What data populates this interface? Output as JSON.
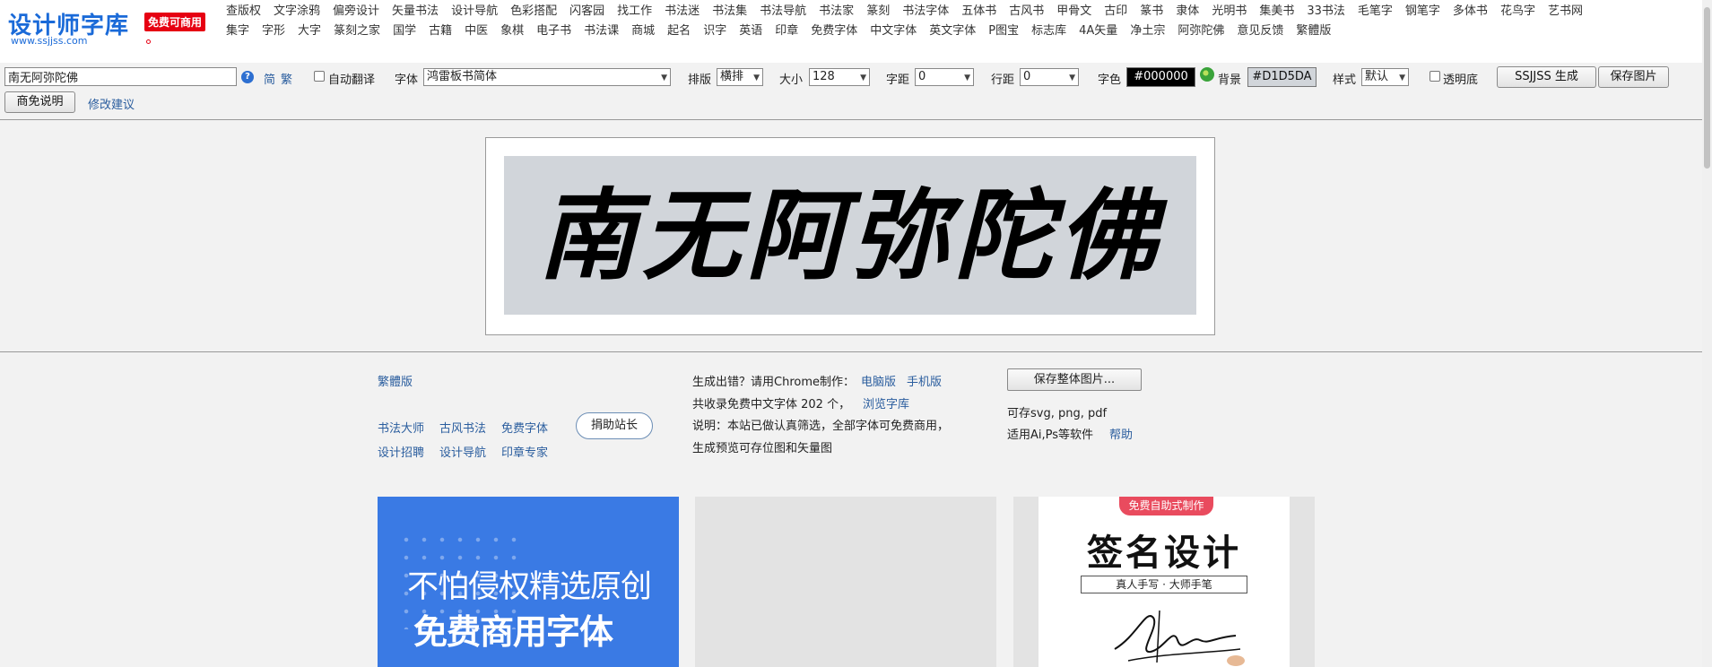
{
  "logo": {
    "name": "设计师字库",
    "badge": "免费可商用",
    "url": "www.ssjjss.com"
  },
  "nav": {
    "row1": [
      "查版权",
      "文字涂鸦",
      "偏旁设计",
      "矢量书法",
      "设计导航",
      "色彩搭配",
      "闪客园",
      "找工作",
      "书法迷",
      "书法集",
      "书法导航",
      "书法家",
      "篆刻",
      "书法字体",
      "五体书",
      "古风书",
      "甲骨文",
      "古印",
      "篆书",
      "隶体",
      "光明书",
      "集美书",
      "33书法",
      "毛笔字",
      "钢笔字",
      "多体书",
      "花鸟字",
      "艺书网"
    ],
    "row2": [
      "集字",
      "字形",
      "大字",
      "篆刻之家",
      "国学",
      "古籍",
      "中医",
      "象棋",
      "电子书",
      "书法课",
      "商城",
      "起名",
      "识字",
      "英语",
      "印章",
      "免费字体",
      "中文字体",
      "英文字体",
      "P图宝",
      "标志库",
      "4A矢量",
      "净土宗",
      "阿弥陀佛",
      "意见反馈",
      "繁體版"
    ]
  },
  "toolbar": {
    "text_value": "南无阿弥陀佛",
    "help_icon": "question-circle-icon",
    "simplified": "简",
    "traditional": "繁",
    "auto_translate": "自动翻译",
    "font_label": "字体",
    "font_value": "鸿雷板书简体",
    "layout_label": "排版",
    "layout_value": "横排",
    "size_label": "大小",
    "size_value": "128",
    "spacing_label": "字距",
    "spacing_value": "0",
    "line_label": "行距",
    "line_value": "0",
    "color_label": "字色",
    "color_value": "#000000",
    "bg_label": "背景",
    "bg_value": "#D1D5DA",
    "style_label": "样式",
    "style_value": "默认",
    "transparent": "透明底",
    "generate_button": "SSJJSS 生成",
    "save_button": "保存图片",
    "commercial_button": "商免说明",
    "suggest_link": "修改建议",
    "colors": {
      "text": "#000000",
      "background": "#D1D5DA",
      "swatch_icon": "palette-icon"
    }
  },
  "preview": {
    "text": "南无阿弥陀佛"
  },
  "footer": {
    "traditional_link": "繁體版",
    "links_row1": [
      "书法大师",
      "古风书法",
      "免费字体"
    ],
    "links_row2": [
      "设计招聘",
      "设计导航",
      "印章专家"
    ],
    "donate_button": "捐助站长",
    "error_text": "生成出错？请用Chrome制作：",
    "pc_link": "电脑版",
    "mobile_link": "手机版",
    "count_text": "共收录免费中文字体 202 个，",
    "browse_link": "浏览字库",
    "desc_line1": "说明：本站已做认真筛选，全部字体可免费商用，",
    "desc_line2": "生成预览可存位图和矢量图",
    "save_all_button": "保存整体图片...",
    "formats_text": "可存svg, png, pdf",
    "software_text": "适用Ai,Ps等软件",
    "help_link": "帮助"
  },
  "ads": {
    "ad1_line1": "不怕侵权精选原创",
    "ad1_line2": "免费商用字体",
    "ad3_badge": "免费自助式制作",
    "ad3_title": "签名设计",
    "ad3_sub": "真人手写 · 大师手笔"
  }
}
